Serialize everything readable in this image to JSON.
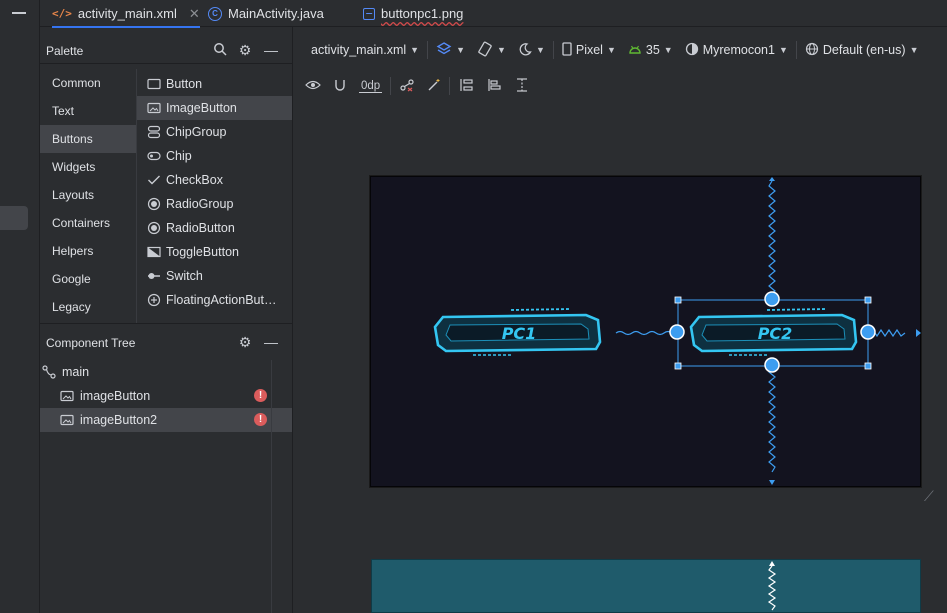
{
  "tabs": [
    {
      "label": "activity_main.xml",
      "icon": "xml-file-icon",
      "active": true,
      "closable": true
    },
    {
      "label": "MainActivity.java",
      "icon": "java-class-icon",
      "active": false
    },
    {
      "label": "buttonpc1.png",
      "icon": "image-file-icon",
      "active": false
    }
  ],
  "palette": {
    "title": "Palette",
    "categories": [
      "Common",
      "Text",
      "Buttons",
      "Widgets",
      "Layouts",
      "Containers",
      "Helpers",
      "Google",
      "Legacy"
    ],
    "selected_category": "Buttons",
    "widgets": [
      {
        "label": "Button",
        "icon": "button-icon"
      },
      {
        "label": "ImageButton",
        "icon": "image-button-icon"
      },
      {
        "label": "ChipGroup",
        "icon": "chip-group-icon"
      },
      {
        "label": "Chip",
        "icon": "chip-icon"
      },
      {
        "label": "CheckBox",
        "icon": "checkbox-icon"
      },
      {
        "label": "RadioGroup",
        "icon": "radio-group-icon"
      },
      {
        "label": "RadioButton",
        "icon": "radio-button-icon"
      },
      {
        "label": "ToggleButton",
        "icon": "toggle-button-icon"
      },
      {
        "label": "Switch",
        "icon": "switch-icon"
      },
      {
        "label": "FloatingActionBut…",
        "icon": "fab-icon"
      }
    ],
    "selected_widget": "ImageButton"
  },
  "component_tree": {
    "title": "Component Tree",
    "nodes": [
      {
        "label": "main",
        "icon": "constraint-layout-icon",
        "level": 0,
        "error": false
      },
      {
        "label": "imageButton",
        "icon": "image-button-icon",
        "level": 1,
        "error": true
      },
      {
        "label": "imageButton2",
        "icon": "image-button-icon",
        "level": 1,
        "error": true,
        "selected": true
      }
    ]
  },
  "toolbar": {
    "file_dropdown": "activity_main.xml",
    "device": "Pixel",
    "api_level": "35",
    "theme": "Myremocon1",
    "locale": "Default (en-us)",
    "default_margin": "0dp"
  },
  "design": {
    "button1_text": "PC1",
    "button2_text": "PC2",
    "background_color": "#13131f",
    "accent_color": "#3d9df0",
    "button_color": "#34c6f2",
    "blueprint_color": "#1f5b6b"
  }
}
